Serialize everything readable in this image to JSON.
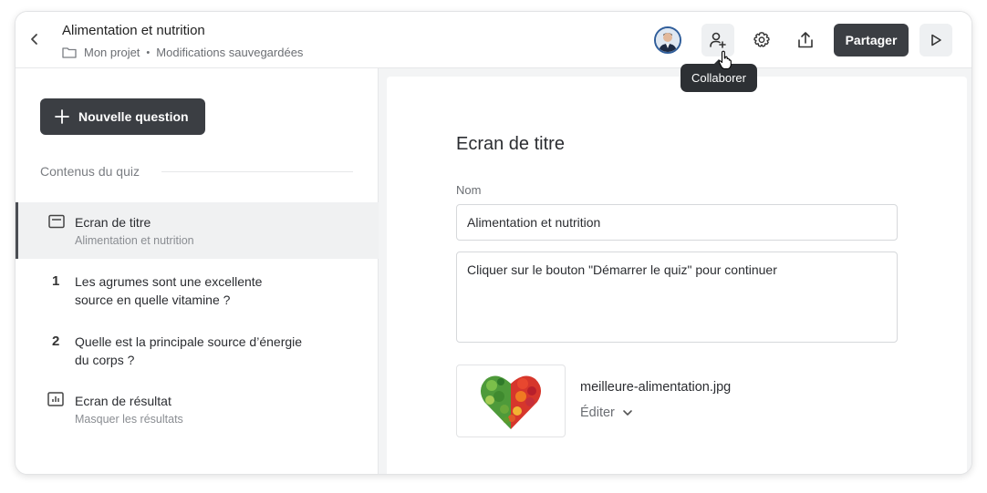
{
  "header": {
    "back_icon": "chevron-left-icon",
    "title": "Alimentation et nutrition",
    "folder_icon": "folder-icon",
    "project": "Mon projet",
    "separator": "•",
    "save_status": "Modifications sauvegardées",
    "avatar_icon": "user-avatar",
    "collaborate_icon": "user-plus-icon",
    "settings_icon": "gear-icon",
    "export_icon": "upload-icon",
    "share_label": "Partager",
    "play_icon": "play-icon",
    "tooltip": "Collaborer"
  },
  "sidebar": {
    "new_question_label": "Nouvelle question",
    "section_title": "Contenus du quiz",
    "items": [
      {
        "icon": "title-screen-icon",
        "label": "Ecran de titre",
        "sublabel": "Alimentation et nutrition",
        "selected": true
      },
      {
        "number": "1",
        "label": "Les agrumes sont une excellente source en quelle vitamine ?"
      },
      {
        "number": "2",
        "label": "Quelle est la principale source d’énergie du corps ?"
      },
      {
        "icon": "bar-chart-icon",
        "label": "Ecran de résultat",
        "sublabel": "Masquer les résultats"
      }
    ]
  },
  "editor": {
    "title": "Ecran de titre",
    "name_label": "Nom",
    "name_value": "Alimentation et nutrition",
    "description_value": "Cliquer sur le bouton \"Démarrer le quiz\" pour continuer",
    "image_file": "meilleure-alimentation.jpg",
    "edit_label": "Éditer",
    "image_icon": "heart-of-vegetables-image"
  },
  "colors": {
    "accent_dark": "#3b3e43",
    "selected_bg": "#f0f1f2",
    "avatar_ring": "#2f5d9a"
  }
}
